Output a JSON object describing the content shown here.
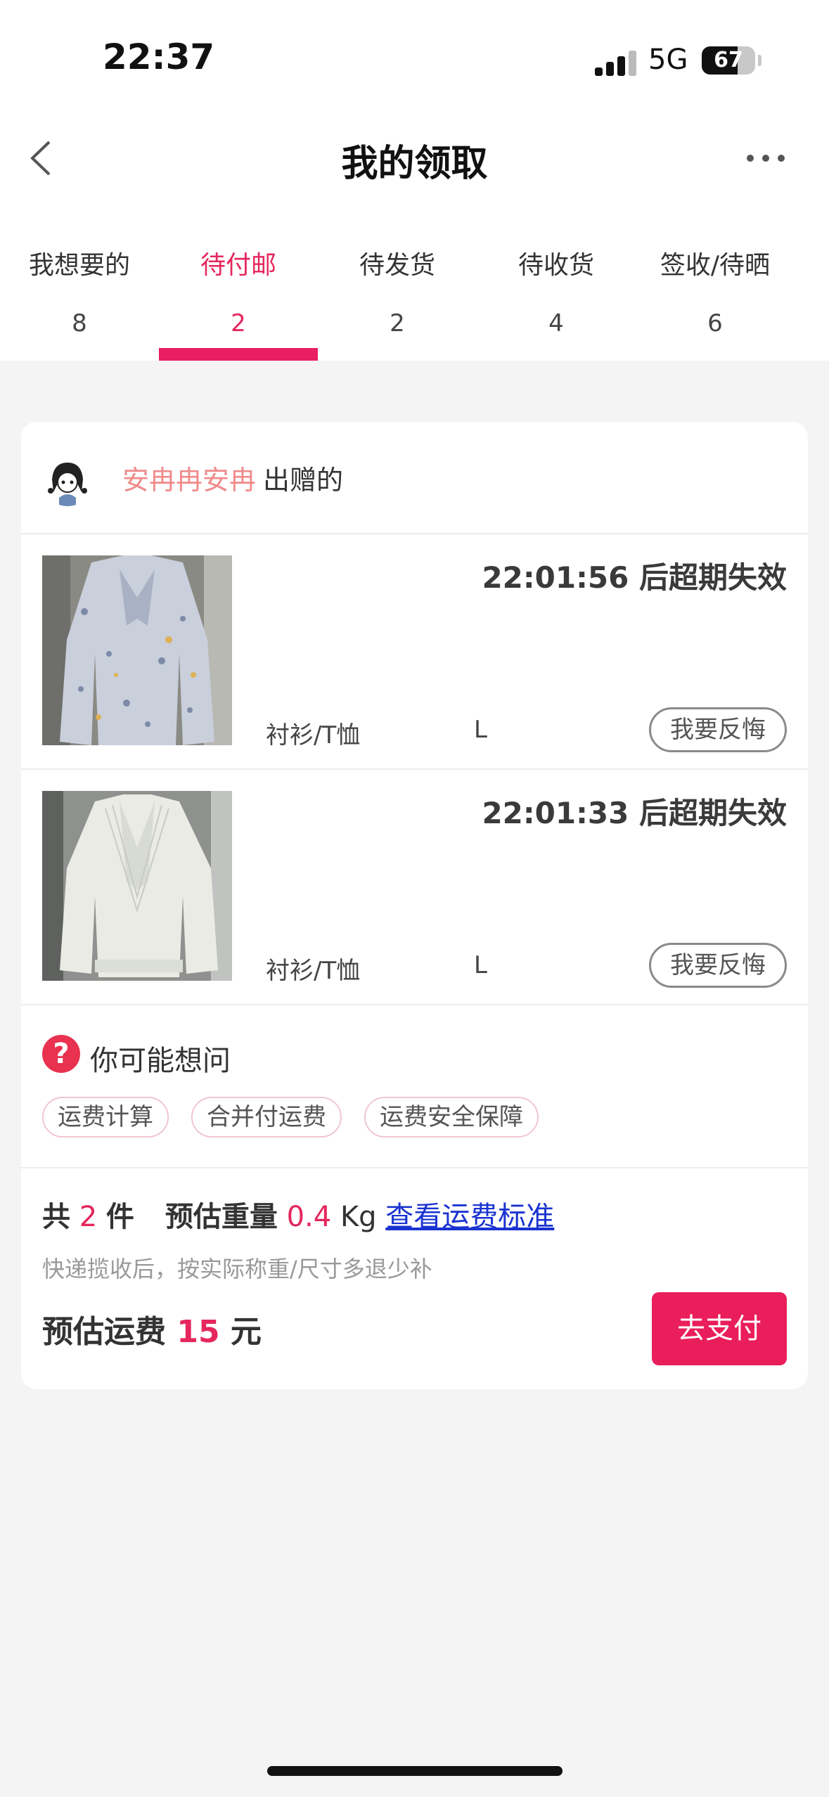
{
  "status": {
    "time": "22:37",
    "network": "5G",
    "battery": "67"
  },
  "nav": {
    "title": "我的领取",
    "back_icon": "chevron-left-icon",
    "more_icon": "more-dots-icon"
  },
  "tabs": [
    {
      "label": "我想要的",
      "count": "8",
      "active": false
    },
    {
      "label": "待付邮",
      "count": "2",
      "active": true
    },
    {
      "label": "待发货",
      "count": "2",
      "active": false
    },
    {
      "label": "待收货",
      "count": "4",
      "active": false
    },
    {
      "label": "签收/待晒",
      "count": "6",
      "active": false
    }
  ],
  "card": {
    "giver_name": "安冉冉安冉",
    "giver_suffix": "出赠的",
    "items": [
      {
        "expire": "22:01:56 后超期失效",
        "category": "衬衫/T恤",
        "size": "L",
        "action": "我要反悔",
        "image": "floral-blouse"
      },
      {
        "expire": "22:01:33 后超期失效",
        "category": "衬衫/T恤",
        "size": "L",
        "action": "我要反悔",
        "image": "white-lace-blouse"
      }
    ],
    "faq": {
      "icon": "?",
      "title": "你可能想问",
      "chips": [
        "运费计算",
        "合并付运费",
        "运费安全保障"
      ]
    },
    "summary": {
      "total_prefix": "共",
      "total_count": "2",
      "total_unit": "件",
      "weight_label": "预估重量",
      "weight_value": "0.4",
      "weight_unit": "Kg",
      "link": "查看运费标准",
      "note": "快递揽收后，按实际称重/尺寸多退少补",
      "fee_label": "预估运费",
      "fee_value": "15",
      "fee_unit": "元",
      "pay_button": "去支付"
    }
  },
  "colors": {
    "accent": "#e91e5b",
    "giver": "#f08a8a",
    "link": "#1a33d1"
  }
}
